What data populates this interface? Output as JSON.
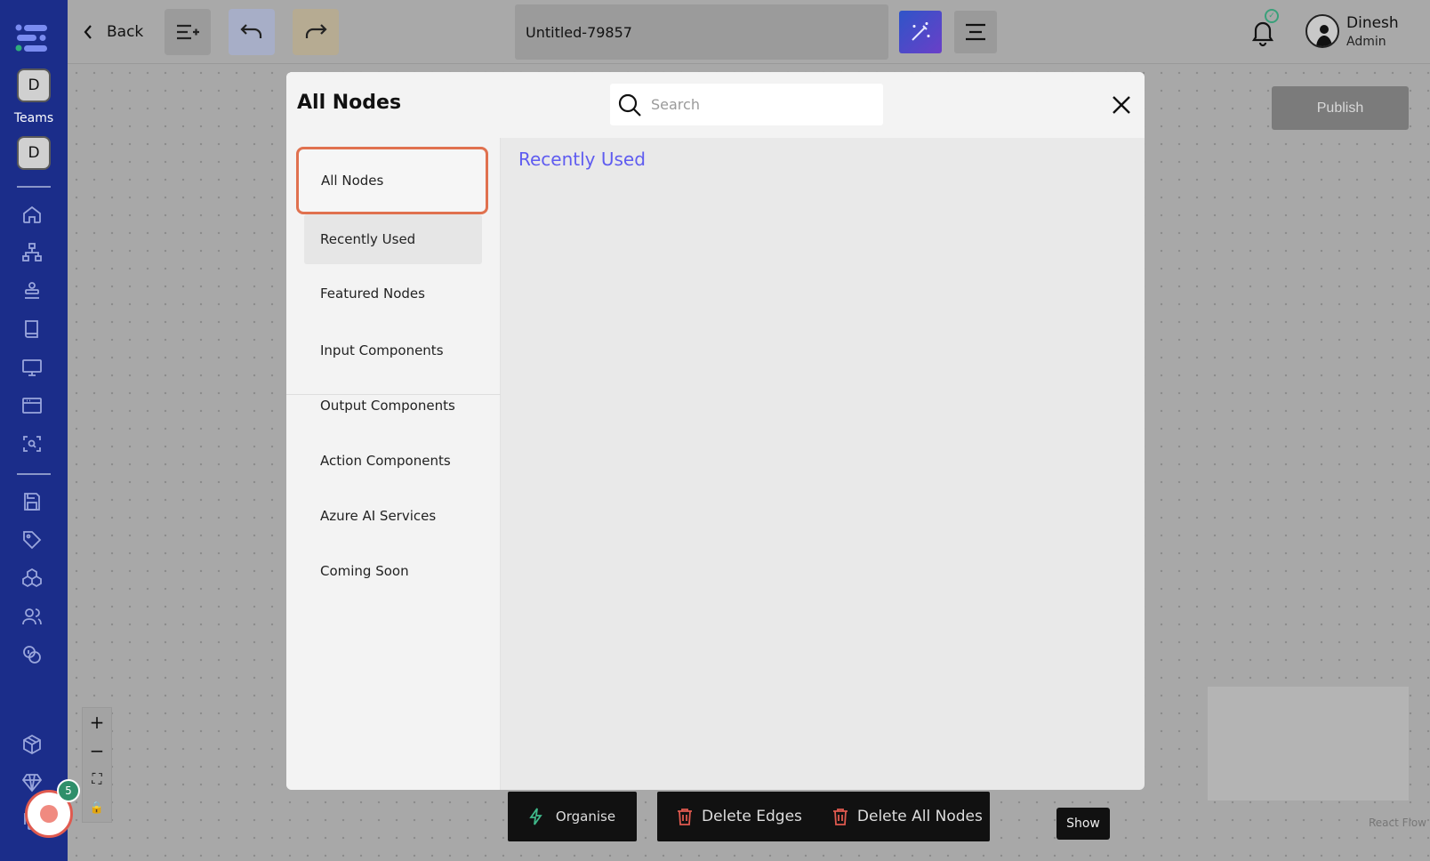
{
  "rail": {
    "team_initial_1": "D",
    "teams_label": "Teams",
    "team_initial_2": "D",
    "icons": [
      "home-icon",
      "workflow-icon",
      "stack-icon",
      "book-icon",
      "monitor-icon",
      "browser-window-icon",
      "scan-search-icon",
      "save-icon",
      "tag-icon",
      "cubes-icon",
      "users-icon",
      "coins-icon",
      "package-icon",
      "diamond-icon",
      "copy-icon"
    ]
  },
  "topbar": {
    "back_label": "Back",
    "project_title": "Untitled-79857",
    "user_name": "Dinesh",
    "user_role": "Admin",
    "colors": {
      "add_button": "#9b9b9b",
      "undo_button": "#a7aec7",
      "redo_button": "#b6ab92"
    }
  },
  "canvas": {
    "publish_label": "Publish",
    "zoom_controls": [
      "+",
      "−",
      "⛶",
      "🔒"
    ],
    "fab_badge_count": "5",
    "organise_label": "Organise",
    "delete_edges_label": "Delete Edges",
    "delete_all_nodes_label": "Delete All Nodes",
    "show_label": "Show",
    "attribution": "React Flow"
  },
  "modal": {
    "title": "All Nodes",
    "search_placeholder": "Search",
    "section_title": "Recently Used",
    "categories": [
      {
        "label": "All Nodes",
        "state": "active"
      },
      {
        "label": "Recently Used",
        "state": "hover"
      },
      {
        "label": "Featured Nodes",
        "state": "normal"
      },
      {
        "label": "Input Components",
        "state": "normal"
      },
      {
        "label": "Output Components",
        "state": "normal"
      },
      {
        "label": "Action Components",
        "state": "normal"
      },
      {
        "label": "Azure AI Services",
        "state": "normal"
      },
      {
        "label": "Coming Soon",
        "state": "normal"
      }
    ],
    "accent_color": "#5f5cf0",
    "active_border_color": "#e0714f"
  }
}
